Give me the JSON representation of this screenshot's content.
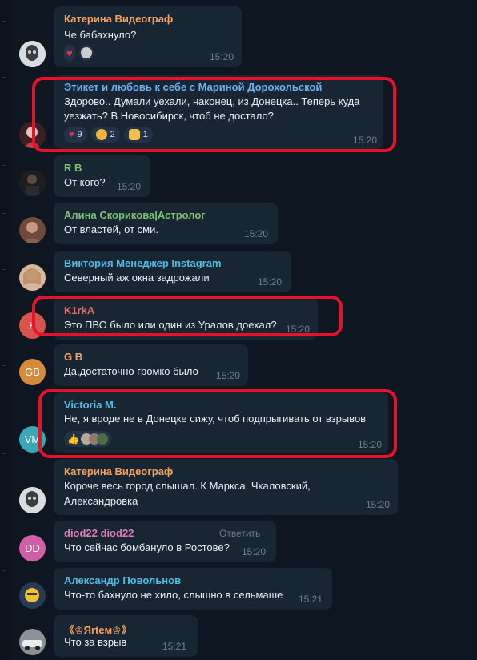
{
  "messages": [
    {
      "name": "Катерина Видеограф",
      "name_color": "#f5a35c",
      "lines": [
        "Че бабахнуло?"
      ],
      "time": "15:20",
      "reactions": [
        {
          "emoji": "heart",
          "count": ""
        },
        {
          "emoji": "avatar-gray",
          "count": ""
        }
      ]
    },
    {
      "name": "Этикет и любовь к себе с Мариной Дорохольской",
      "name_color": "#6ab2f2",
      "lines": [
        "Здорово.. Думали уехали, наконец, из Донецка.. Теперь куда",
        "уезжать? В Новосибирск, чтоб не достало?"
      ],
      "time": "15:20",
      "reactions": [
        {
          "emoji": "heart",
          "count": "9"
        },
        {
          "emoji": "face-cowboy",
          "count": "2"
        },
        {
          "emoji": "pray",
          "count": "1"
        }
      ]
    },
    {
      "name": "R B",
      "name_color": "#7ec36e",
      "lines": [
        "От кого?"
      ],
      "time": "15:20"
    },
    {
      "name": "Алина Скорикова|Астролог",
      "name_color": "#7ec36e",
      "lines": [
        "От властей, от сми."
      ],
      "time": "15:20"
    },
    {
      "name": "Виктория Менеджер Instagram",
      "name_color": "#52bde3",
      "lines": [
        "Северный аж окна задрожали"
      ],
      "time": "15:20"
    },
    {
      "name": "K1rkA",
      "name_color": "#e56a6a",
      "lines": [
        "Это ПВО было или один из Уралов доехал?"
      ],
      "time": "15:20",
      "initials": "K",
      "avatar_color": "#d6534e"
    },
    {
      "name": "G B",
      "name_color": "#f5a35c",
      "lines": [
        "Да,достаточно громко было"
      ],
      "time": "15:20",
      "initials": "GB",
      "avatar_color": "#d68b3c"
    },
    {
      "name": "Victoria M.",
      "name_color": "#52bde3",
      "lines": [
        "Не, я вроде не в Донецке сижу, чтоб подпрыгивать от взрывов"
      ],
      "time": "15:20",
      "initials": "VM",
      "avatar_color": "#3aa9b6",
      "reactions": [
        {
          "emoji": "thumbs-up",
          "count": ""
        }
      ]
    },
    {
      "name": "Катерина Видеограф",
      "name_color": "#f5a35c",
      "lines": [
        "Короче весь город слышал. К Маркса, Чкаловский,",
        "Александровка"
      ],
      "time": "15:20"
    },
    {
      "name": "diod22 diod22",
      "name_color": "#e57ac2",
      "lines": [
        "Что сейчас бомбануло в Ростове?"
      ],
      "time": "15:20",
      "initials": "DD",
      "avatar_color": "#d05fa6",
      "reply_label": "Ответить"
    },
    {
      "name": "Александр Повольнов",
      "name_color": "#52bde3",
      "lines": [
        "Что-то бахнуло не хило, слышно в сельмаше"
      ],
      "time": "15:21"
    },
    {
      "name": "《♔Яrtем♔》",
      "name_color": "#f5a35c",
      "lines": [
        "Что за взрыв"
      ],
      "time": "15:21"
    }
  ],
  "colors": {
    "background": "#0e1621",
    "bubble": "#182533",
    "highlight": "#e8102a"
  }
}
